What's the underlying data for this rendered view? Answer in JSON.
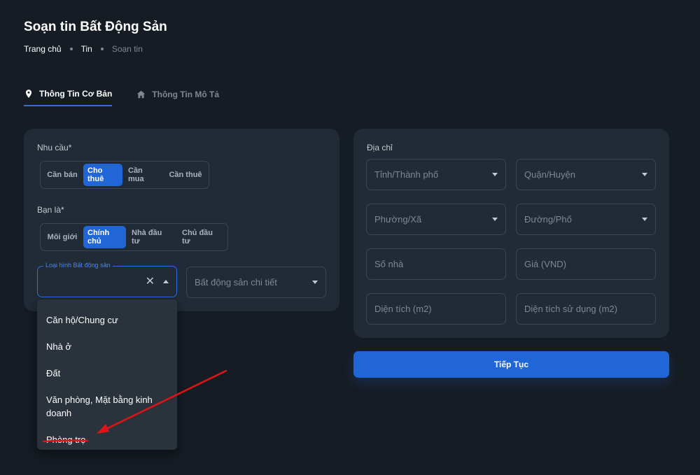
{
  "header": {
    "title": "Soạn tin Bất Động Sản",
    "breadcrumb": [
      "Trang chủ",
      "Tin",
      "Soạn tin"
    ]
  },
  "tabs": [
    {
      "label": "Thông Tin Cơ Bản",
      "icon": "location-pin-icon",
      "active": true
    },
    {
      "label": "Thông Tin Mô Tả",
      "icon": "home-icon",
      "active": false
    }
  ],
  "basic": {
    "need": {
      "label": "Nhu cầu*",
      "options": [
        "Cần bán",
        "Cho thuê",
        "Cần mua",
        "Cần thuê"
      ],
      "selected": "Cho thuê"
    },
    "role": {
      "label": "Bạn là*",
      "options": [
        "Môi giới",
        "Chính chủ",
        "Nhà đầu tư",
        "Chủ đầu tư"
      ],
      "selected": "Chính chủ"
    },
    "property_type": {
      "label": "Loại hình Bất động sản",
      "value": ""
    },
    "property_detail": {
      "placeholder": "Bất động sản chi tiết"
    }
  },
  "dropdown": {
    "items": [
      "Căn hộ/Chung cư",
      "Nhà ở",
      "Đất",
      "Văn phòng, Mặt bằng kinh doanh",
      "Phòng trọ"
    ],
    "highlighted": "Phòng trọ"
  },
  "address": {
    "label": "Địa chỉ",
    "province": "Tỉnh/Thành phố",
    "district": "Quận/Huyện",
    "ward": "Phường/Xã",
    "street": "Đường/Phố",
    "house_no": "Số nhà",
    "price": "Giá (VND)",
    "area": "Diện tích (m2)",
    "usable_area": "Diện tích sử dụng (m2)"
  },
  "actions": {
    "continue": "Tiếp Tục"
  },
  "colors": {
    "background": "#161c24",
    "card": "#212b36",
    "accent": "#2066d6",
    "annotation": "#e01414"
  }
}
